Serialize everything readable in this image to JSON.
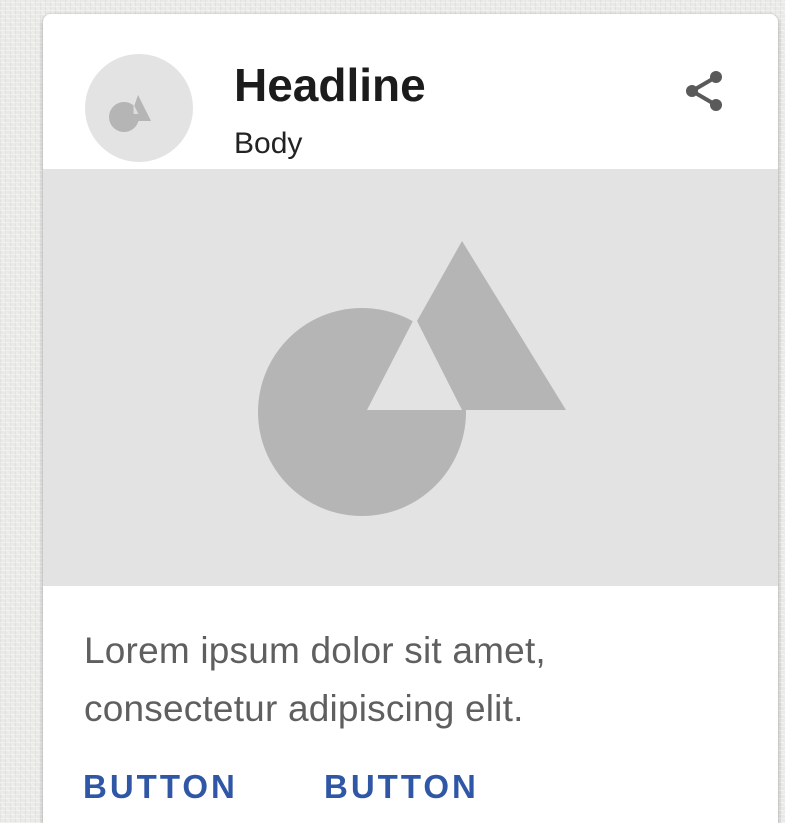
{
  "card": {
    "headline": "Headline",
    "subhead": "Body",
    "supporting_text": "Lorem ipsum dolor sit amet, consectetur adipiscing elit.",
    "actions": [
      {
        "label": "BUTTON"
      },
      {
        "label": "BUTTON"
      }
    ]
  },
  "icons": {
    "avatar": "shapes-placeholder-icon",
    "share": "share-icon",
    "media": "image-placeholder-icon"
  },
  "colors": {
    "card_background": "#ffffff",
    "placeholder_background": "#e3e3e3",
    "placeholder_shape": "#b5b5b5",
    "headline_text": "#1c1c1c",
    "body_text": "#5f5f5f",
    "action_text": "#2f57a6",
    "icon": "#5a5a5a"
  }
}
